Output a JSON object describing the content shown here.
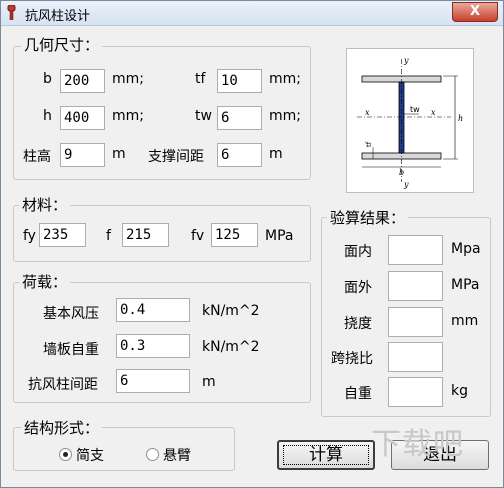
{
  "window": {
    "title": "抗风柱设计",
    "close_glyph": "X"
  },
  "geometry": {
    "legend": "几何尺寸：",
    "b": {
      "label": "b",
      "value": "200",
      "unit": "mm;"
    },
    "h": {
      "label": "h",
      "value": "400",
      "unit": "mm;"
    },
    "tf": {
      "label": "tf",
      "value": "10",
      "unit": "mm;"
    },
    "tw": {
      "label": "tw",
      "value": "6",
      "unit": "mm;"
    },
    "column_height": {
      "label": "柱高",
      "value": "9",
      "unit": "m"
    },
    "brace_spacing": {
      "label": "支撑间距",
      "value": "6",
      "unit": "m"
    }
  },
  "diagram": {
    "y_top": "y",
    "y_bottom": "y",
    "x_left": "x",
    "x_right": "x",
    "tw": "tw",
    "tf": "tf",
    "b": "b",
    "h": "h"
  },
  "material": {
    "legend": "材料：",
    "fy": {
      "label": "fy",
      "value": "235"
    },
    "f": {
      "label": "f",
      "value": "215"
    },
    "fv": {
      "label": "fv",
      "value": "125",
      "unit": "MPa"
    }
  },
  "load": {
    "legend": "荷载：",
    "wind_pressure": {
      "label": "基本风压",
      "value": "0.4",
      "unit": "kN/m^2"
    },
    "wall_weight": {
      "label": "墙板自重",
      "value": "0.3",
      "unit": "kN/m^2"
    },
    "column_spacing": {
      "label": "抗风柱间距",
      "value": "6",
      "unit": "m"
    }
  },
  "results": {
    "legend": "验算结果：",
    "in_plane": {
      "label": "面内",
      "value": "",
      "unit": "Mpa"
    },
    "out_plane": {
      "label": "面外",
      "value": "",
      "unit": "MPa"
    },
    "deflection": {
      "label": "挠度",
      "value": "",
      "unit": "mm"
    },
    "span_ratio": {
      "label": "跨挠比",
      "value": ""
    },
    "self_weight": {
      "label": "自重",
      "value": "",
      "unit": "kg"
    }
  },
  "structure": {
    "legend": "结构形式：",
    "options": [
      {
        "label": "简支",
        "selected": true
      },
      {
        "label": "悬臂",
        "selected": false
      }
    ]
  },
  "buttons": {
    "calculate": "计算",
    "exit": "退出"
  },
  "watermark": "下载吧"
}
